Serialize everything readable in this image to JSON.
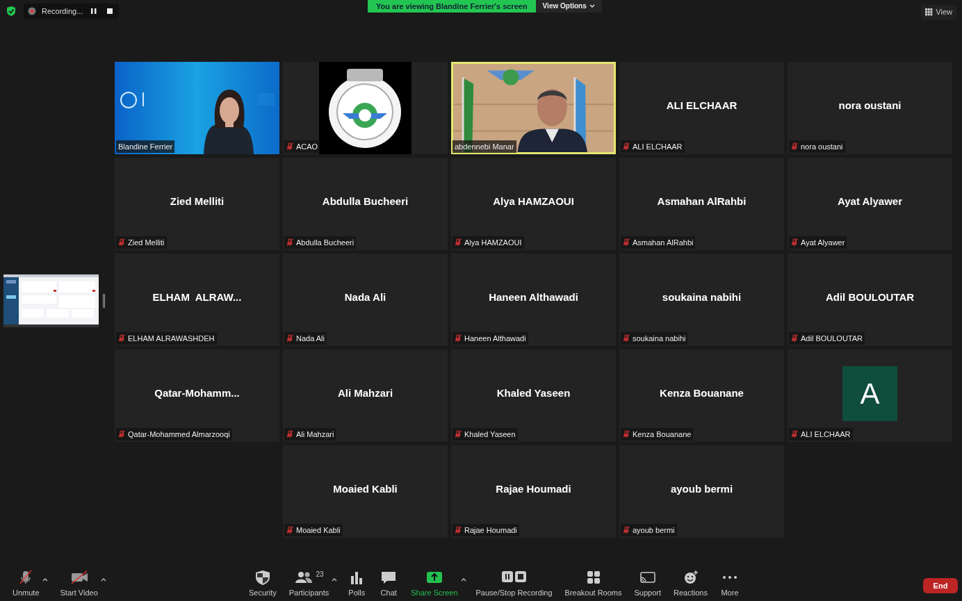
{
  "top_bar": {
    "recording": {
      "label": "Recording..."
    },
    "banner": "You are viewing Blandine Ferrier's screen",
    "view_options": "View Options",
    "view": "View"
  },
  "tile_rows": [
    [
      {
        "kind": "video",
        "name": "Blandine Ferrier",
        "muted": false,
        "active_speaker": false
      },
      {
        "kind": "video",
        "name": "ACAO",
        "muted": true,
        "active_speaker": false
      },
      {
        "kind": "video",
        "name": "abdennebi Manar",
        "muted": false,
        "active_speaker": true
      },
      {
        "kind": "name",
        "title": "ALI ELCHAAR",
        "name": "ALI ELCHAAR",
        "muted": true,
        "active_speaker": false
      },
      {
        "kind": "name",
        "title": "nora oustani",
        "name": "nora oustani",
        "muted": true,
        "active_speaker": false
      }
    ],
    [
      {
        "kind": "name",
        "title": "Zied Melliti",
        "name": "Zied Melliti",
        "muted": true,
        "active_speaker": false
      },
      {
        "kind": "name",
        "title": "Abdulla Bucheeri",
        "name": "Abdulla Bucheeri",
        "muted": true,
        "active_speaker": false
      },
      {
        "kind": "name",
        "title": "Alya HAMZAOUI",
        "name": "Alya HAMZAOUI",
        "muted": true,
        "active_speaker": false
      },
      {
        "kind": "name",
        "title": "Asmahan AlRahbi",
        "name": "Asmahan AlRahbi",
        "muted": true,
        "active_speaker": false
      },
      {
        "kind": "name",
        "title": "Ayat Alyawer",
        "name": "Ayat Alyawer",
        "muted": true,
        "active_speaker": false
      }
    ],
    [
      {
        "kind": "name",
        "title": "ELHAM  ALRAW...",
        "name": "ELHAM ALRAWASHDEH",
        "muted": true,
        "active_speaker": false
      },
      {
        "kind": "name",
        "title": "Nada Ali",
        "name": "Nada Ali",
        "muted": true,
        "active_speaker": false
      },
      {
        "kind": "name",
        "title": "Haneen Althawadi",
        "name": "Haneen Althawadi",
        "muted": true,
        "active_speaker": false
      },
      {
        "kind": "name",
        "title": "soukaina nabihi",
        "name": "soukaina nabihi",
        "muted": true,
        "active_speaker": false
      },
      {
        "kind": "name",
        "title": "Adil BOULOUTAR",
        "name": "Adil BOULOUTAR",
        "muted": true,
        "active_speaker": false
      }
    ],
    [
      {
        "kind": "name",
        "title": "Qatar-Mohamm...",
        "name": "Qatar-Mohammed Almarzooqi",
        "muted": true,
        "active_speaker": false
      },
      {
        "kind": "name",
        "title": "Ali Mahzari",
        "name": "Ali Mahzari",
        "muted": true,
        "active_speaker": false
      },
      {
        "kind": "name",
        "title": "Khaled Yaseen",
        "name": "Khaled Yaseen",
        "muted": true,
        "active_speaker": false
      },
      {
        "kind": "name",
        "title": "Kenza Bouanane",
        "name": "Kenza Bouanane",
        "muted": true,
        "active_speaker": false
      },
      {
        "kind": "avatar",
        "avatar_letter": "A",
        "color": "#0f4d3d",
        "name": "ALI ELCHAAR",
        "muted": true,
        "active_speaker": false
      }
    ],
    [
      {
        "kind": "name",
        "title": "Moaied Kabli",
        "name": "Moaied Kabli",
        "muted": true,
        "active_speaker": false
      },
      {
        "kind": "name",
        "title": "Rajae Houmadi",
        "name": "Rajae Houmadi",
        "muted": true,
        "active_speaker": false
      },
      {
        "kind": "name",
        "title": "ayoub bermi",
        "name": "ayoub bermi",
        "muted": true,
        "active_speaker": false
      }
    ]
  ],
  "toolbar": {
    "left": [
      {
        "kind": "audio",
        "label": "Unmute",
        "caret": true
      },
      {
        "kind": "video",
        "label": "Start Video",
        "caret": true
      }
    ],
    "center": [
      {
        "kind": "security",
        "label": "Security",
        "caret": false
      },
      {
        "kind": "participants",
        "label": "Participants",
        "count": "23",
        "caret": true
      },
      {
        "kind": "polls",
        "label": "Polls",
        "caret": false
      },
      {
        "kind": "chat",
        "label": "Chat",
        "caret": false
      },
      {
        "kind": "share",
        "label": "Share Screen",
        "caret": true
      },
      {
        "kind": "recording",
        "label": "Pause/Stop Recording",
        "caret": false
      },
      {
        "kind": "breakout",
        "label": "Breakout Rooms",
        "caret": false
      },
      {
        "kind": "support",
        "label": "Support",
        "caret": false
      },
      {
        "kind": "reactions",
        "label": "Reactions",
        "caret": false
      },
      {
        "kind": "more",
        "label": "More",
        "caret": false
      }
    ],
    "end": "End"
  }
}
